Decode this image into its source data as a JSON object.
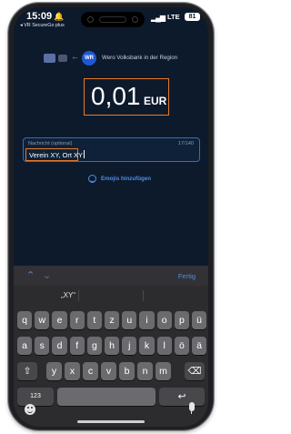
{
  "status_bar": {
    "time": "15:09",
    "back_app_label": "◂ VR SecureGo plus",
    "carrier": "LTE",
    "battery": "81"
  },
  "recipient": {
    "badge": "WR",
    "bank_name": "Wero Volksbank in der Region"
  },
  "amount": {
    "value": "0,01",
    "currency": "EUR"
  },
  "message": {
    "label": "Nachricht (optional)",
    "counter": "17/140",
    "value": "Verein XY, Ort XY"
  },
  "emoji_action": {
    "label": "Emojis hinzufügen"
  },
  "keyboard": {
    "done_label": "Fertig",
    "suggestion": "„XY“",
    "rows": [
      [
        "q",
        "w",
        "e",
        "r",
        "t",
        "z",
        "u",
        "i",
        "o",
        "p",
        "ü"
      ],
      [
        "a",
        "s",
        "d",
        "f",
        "g",
        "h",
        "j",
        "k",
        "l",
        "ö",
        "ä"
      ],
      [
        "⇧",
        "y",
        "x",
        "c",
        "v",
        "b",
        "n",
        "m",
        "⌫"
      ]
    ],
    "numbers_key": "123",
    "return_key": "↩",
    "space_key": ""
  },
  "colors": {
    "background": "#0d1a2c",
    "accent": "#4d8fe8",
    "highlight_outline": "#e8792b",
    "keyboard": "#2c2c2e"
  },
  "icons": [
    "bell-icon",
    "signal-icon",
    "card-icon",
    "arrow-icon",
    "emoji-icon",
    "chevron-up-icon",
    "chevron-down-icon",
    "shift-icon",
    "backspace-icon",
    "return-icon",
    "mic-icon"
  ]
}
